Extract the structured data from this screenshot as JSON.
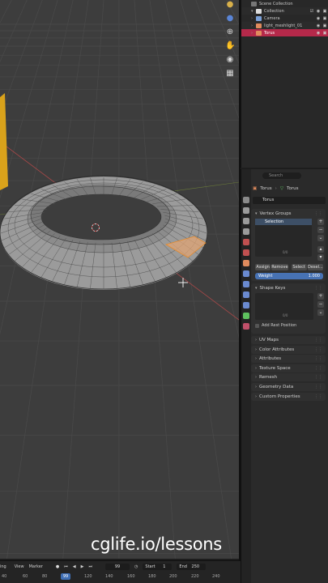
{
  "watermark": "cglife.io/lessons",
  "colors": {
    "selection_red": "#b5294a",
    "accent_blue": "#4772b3",
    "vg_highlight": "#3d4f66",
    "edge_orange": "#e58a2a",
    "viewport_bg": "#3d3d3d"
  },
  "outliner": {
    "items": [
      {
        "label": "Scene Collection",
        "icon": "collection-icon",
        "icon_color": "#9a9a9a"
      },
      {
        "label": "Collection",
        "icon": "collection-icon",
        "icon_color": "#e0e0e0"
      },
      {
        "label": "Camera",
        "icon": "camera-icon",
        "icon_color": "#7aa0d8"
      },
      {
        "label": "light_meshlight_01",
        "icon": "mesh-icon",
        "icon_color": "#e08b5d"
      },
      {
        "label": "Torus",
        "icon": "mesh-icon",
        "icon_color": "#e08b5d"
      }
    ]
  },
  "properties": {
    "search_placeholder": "Search",
    "breadcrumb": {
      "object": "Torus",
      "mesh": "Torus"
    },
    "mesh_name": "Torus",
    "vertex_groups": {
      "title": "Vertex Groups",
      "selected_item": "Selection",
      "buttons": [
        "Assign",
        "Remove",
        "Select",
        "Desel..."
      ],
      "weight_label": "Weight",
      "weight_value": "1.000",
      "list_count": "0/0"
    },
    "shape_keys": {
      "title": "Shape Keys",
      "add_rest_position": "Add Rest Position"
    },
    "collapsed_panels": [
      "UV Maps",
      "Color Attributes",
      "Attributes",
      "Texture Space",
      "Remesh",
      "Geometry Data",
      "Custom Properties"
    ]
  },
  "timeline": {
    "menus": [
      "ing",
      "View",
      "Marker"
    ],
    "current_frame": "99",
    "start_label": "Start",
    "start_value": "1",
    "end_label": "End",
    "end_value": "250",
    "ticks": [
      "40",
      "60",
      "80",
      "99",
      "120",
      "140",
      "160",
      "180",
      "200",
      "220",
      "240"
    ]
  }
}
